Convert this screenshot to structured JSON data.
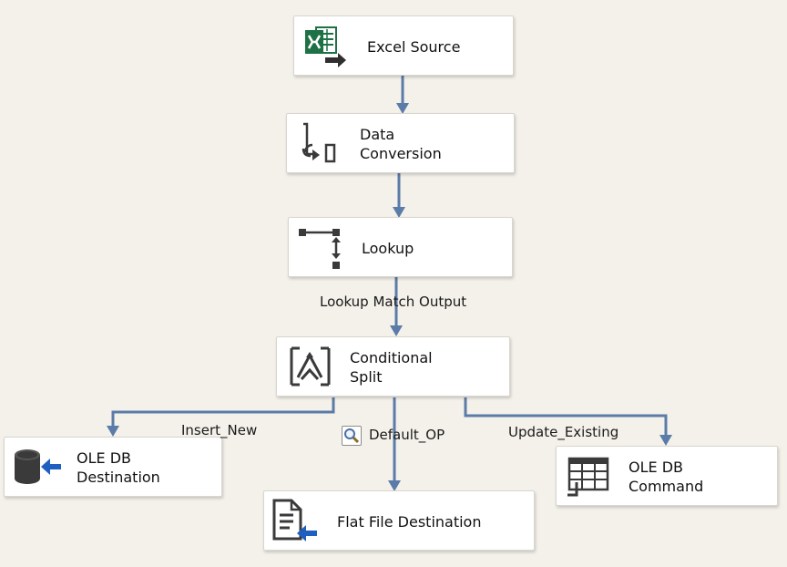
{
  "nodes": {
    "excel_source": {
      "label": "Excel Source"
    },
    "data_conversion": {
      "label": "Data\nConversion"
    },
    "lookup": {
      "label": "Lookup"
    },
    "conditional_split": {
      "label": "Conditional\nSplit"
    },
    "oledb_destination": {
      "label": "OLE DB\nDestination"
    },
    "flat_file_destination": {
      "label": "Flat File Destination"
    },
    "oledb_command": {
      "label": "OLE DB\nCommand"
    }
  },
  "paths": {
    "lookup_match_output": "Lookup Match Output",
    "insert_new": "Insert_New",
    "default_op": "Default_OP",
    "update_existing": "Update_Existing"
  },
  "icons": {
    "excel_source": "excel-icon",
    "data_conversion": "data-conversion-icon",
    "lookup": "lookup-icon",
    "conditional_split": "conditional-split-icon",
    "oledb_destination": "database-destination-icon",
    "flat_file_destination": "flat-file-destination-icon",
    "oledb_command": "table-command-icon",
    "data_viewer": "data-viewer-magnifier-icon"
  },
  "colors": {
    "canvas": "#f4f1ea",
    "connector": "#5b7ba8",
    "excel_green": "#1e7145",
    "destination_blue": "#1f5fbf"
  }
}
